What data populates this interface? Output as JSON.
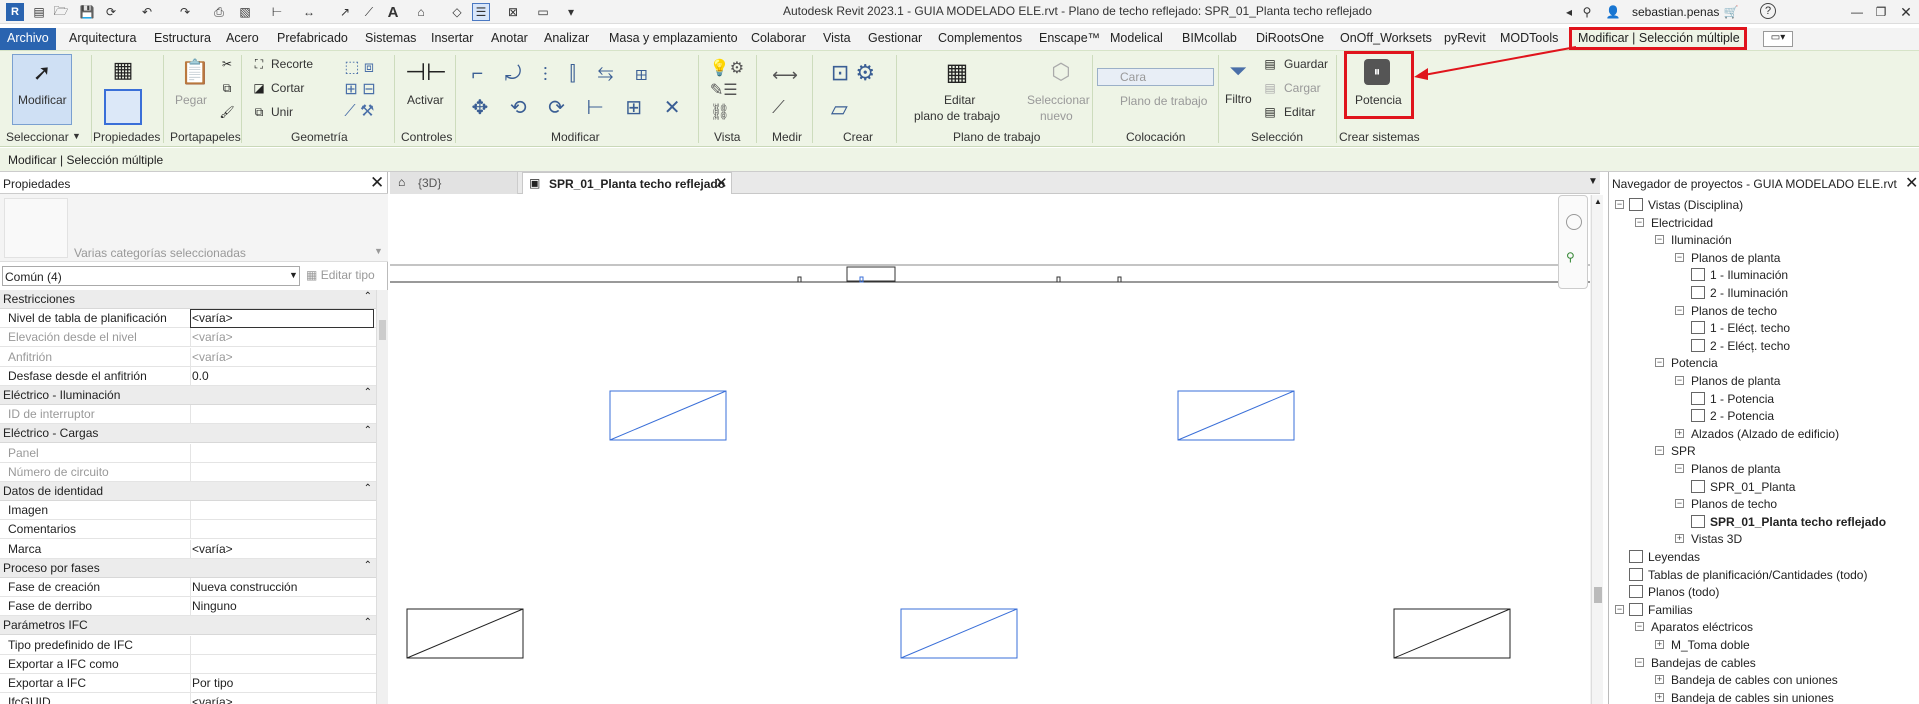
{
  "title": "Autodesk Revit 2023.1 - GUIA MODELADO ELE.rvt - Plano de techo reflejado: SPR_01_Planta techo reflejado",
  "user": "sebastian.penas",
  "menu": [
    "Archivo",
    "Arquitectura",
    "Estructura",
    "Acero",
    "Prefabricado",
    "Sistemas",
    "Insertar",
    "Anotar",
    "Analizar",
    "Masa y emplazamiento",
    "Colaborar",
    "Vista",
    "Gestionar",
    "Complementos",
    "Enscape™",
    "Modelical",
    "BIMcollab",
    "DiRootsOne",
    "OnOff_Worksets",
    "pyRevit",
    "MODTools",
    "Modificar | Selección múltiple"
  ],
  "ribbon": {
    "modificar": "Modificar",
    "pegar": "Pegar",
    "recorte": "Recorte",
    "cortar": "Cortar",
    "unir": "Unir",
    "activar": "Activar",
    "editar_plano_1": "Editar",
    "editar_plano_2": "plano de trabajo",
    "seleccionar_nuevo_1": "Seleccionar",
    "seleccionar_nuevo_2": "nuevo",
    "cara": "Cara",
    "plano_trabajo": "Plano de trabajo",
    "filtro": "Filtro",
    "guardar": "Guardar",
    "cargar": "Cargar",
    "editar": "Editar",
    "potencia": "Potencia",
    "panels": [
      "Seleccionar",
      "Propiedades",
      "Portapapeles",
      "Geometría",
      "Controles",
      "Modificar",
      "Vista",
      "Medir",
      "Crear",
      "Plano de trabajo",
      "Colocación",
      "Selección",
      "Crear sistemas"
    ]
  },
  "context_label": "Modificar | Selección múltiple",
  "properties": {
    "header": "Propiedades",
    "type_name": "Varias categorías seleccionadas",
    "filter": "Común (4)",
    "edit_type": "Editar tipo",
    "rows": [
      {
        "kind": "group",
        "label": "Restricciones"
      },
      {
        "kind": "row",
        "key": "Nivel de tabla de planificación",
        "value": "<varía>",
        "disabled": false,
        "boxed": true
      },
      {
        "kind": "row",
        "key": "Elevación desde el nivel",
        "value": "<varía>",
        "disabled": true
      },
      {
        "kind": "row",
        "key": "Anfitrión",
        "value": "<varía>",
        "disabled": true
      },
      {
        "kind": "row",
        "key": "Desfase desde el anfitrión",
        "value": "0.0",
        "disabled": false
      },
      {
        "kind": "group",
        "label": "Eléctrico - Iluminación"
      },
      {
        "kind": "row",
        "key": "ID de interruptor",
        "value": "",
        "disabled": true
      },
      {
        "kind": "group",
        "label": "Eléctrico - Cargas"
      },
      {
        "kind": "row",
        "key": "Panel",
        "value": "",
        "disabled": true
      },
      {
        "kind": "row",
        "key": "Número de circuito",
        "value": "",
        "disabled": true
      },
      {
        "kind": "group",
        "label": "Datos de identidad"
      },
      {
        "kind": "row",
        "key": "Imagen",
        "value": "",
        "disabled": false
      },
      {
        "kind": "row",
        "key": "Comentarios",
        "value": "",
        "disabled": false
      },
      {
        "kind": "row",
        "key": "Marca",
        "value": "<varía>",
        "disabled": false
      },
      {
        "kind": "group",
        "label": "Proceso por fases"
      },
      {
        "kind": "row",
        "key": "Fase de creación",
        "value": "Nueva construcción",
        "disabled": false
      },
      {
        "kind": "row",
        "key": "Fase de derribo",
        "value": "Ninguno",
        "disabled": false
      },
      {
        "kind": "group",
        "label": "Parámetros IFC"
      },
      {
        "kind": "row",
        "key": "Tipo predefinido de IFC",
        "value": "",
        "disabled": false
      },
      {
        "kind": "row",
        "key": "Exportar a IFC como",
        "value": "",
        "disabled": false
      },
      {
        "kind": "row",
        "key": "Exportar a IFC",
        "value": "Por tipo",
        "disabled": false
      },
      {
        "kind": "row",
        "key": "IfcGUID",
        "value": "<varía>",
        "disabled": false
      }
    ]
  },
  "tabs": [
    {
      "label": "{3D}",
      "active": false
    },
    {
      "label": "SPR_01_Planta techo reflejado",
      "active": true
    }
  ],
  "browser": {
    "header": "Navegador de proyectos - GUIA MODELADO ELE.rvt",
    "items": [
      {
        "label": "Vistas (Disciplina)",
        "level": 0,
        "toggle": "-",
        "icon": "views",
        "bold": false
      },
      {
        "label": "Electricidad",
        "level": 1,
        "toggle": "-"
      },
      {
        "label": "Iluminación",
        "level": 2,
        "toggle": "-"
      },
      {
        "label": "Planos de planta",
        "level": 3,
        "toggle": "-"
      },
      {
        "label": "1 - Iluminación",
        "level": 4,
        "icon": "view"
      },
      {
        "label": "2 - Iluminación",
        "level": 4,
        "icon": "view"
      },
      {
        "label": "Planos de techo",
        "level": 3,
        "toggle": "-"
      },
      {
        "label": "1 - Elécț. techo",
        "level": 4,
        "icon": "view"
      },
      {
        "label": "2 - Elécț. techo",
        "level": 4,
        "icon": "view"
      },
      {
        "label": "Potencia",
        "level": 2,
        "toggle": "-"
      },
      {
        "label": "Planos de planta",
        "level": 3,
        "toggle": "-"
      },
      {
        "label": "1 - Potencia",
        "level": 4,
        "icon": "view"
      },
      {
        "label": "2 - Potencia",
        "level": 4,
        "icon": "view"
      },
      {
        "label": "Alzados (Alzado de edificio)",
        "level": 3,
        "toggle": "+"
      },
      {
        "label": "SPR",
        "level": 2,
        "toggle": "-"
      },
      {
        "label": "Planos de planta",
        "level": 3,
        "toggle": "-"
      },
      {
        "label": "SPR_01_Planta",
        "level": 4,
        "icon": "view"
      },
      {
        "label": "Planos de techo",
        "level": 3,
        "toggle": "-"
      },
      {
        "label": "SPR_01_Planta techo reflejado",
        "level": 4,
        "icon": "view",
        "bold": true
      },
      {
        "label": "Vistas 3D",
        "level": 3,
        "toggle": "+"
      },
      {
        "label": "Leyendas",
        "level": 0,
        "icon": "legend"
      },
      {
        "label": "Tablas de planificación/Cantidades (todo)",
        "level": 0,
        "icon": "table"
      },
      {
        "label": "Planos (todo)",
        "level": 0,
        "icon": "sheet"
      },
      {
        "label": "Familias",
        "level": 0,
        "toggle": "-",
        "icon": "family"
      },
      {
        "label": "Aparatos eléctricos",
        "level": 1,
        "toggle": "-"
      },
      {
        "label": "M_Toma doble",
        "level": 2,
        "toggle": "+"
      },
      {
        "label": "Bandejas de cables",
        "level": 1,
        "toggle": "-"
      },
      {
        "label": "Bandeja de cables con uniones",
        "level": 2,
        "toggle": "+"
      },
      {
        "label": "Bandeja de cables sin uniones",
        "level": 2,
        "toggle": "+"
      }
    ]
  },
  "colors": {
    "archivo_bg": "#2a64b0",
    "highlight": "#e0141c",
    "ribbon_bg": "#eef4e6",
    "selected_blue": "#3a6fd8"
  }
}
